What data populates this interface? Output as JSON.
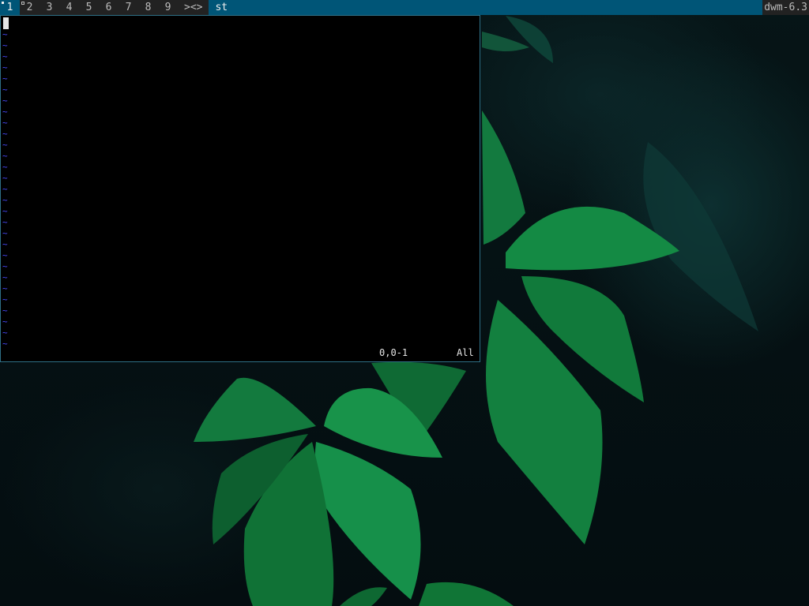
{
  "bar": {
    "tags": [
      "1",
      "2",
      "3",
      "4",
      "5",
      "6",
      "7",
      "8",
      "9"
    ],
    "layout_symbol": "><>",
    "window_title": "st",
    "status_text": "dwm-6.3"
  },
  "vim": {
    "empty_line_marker": "~",
    "cursor_position": "0,0-1",
    "file_position": "All"
  },
  "colors": {
    "bar_background": "#222222",
    "bar_selected": "#005577",
    "bar_text": "#bbbbbb",
    "bar_selected_text": "#eeeeee",
    "window_border": "#2e6f86",
    "terminal_background": "#000000",
    "tilde_color": "#4a4aff"
  }
}
